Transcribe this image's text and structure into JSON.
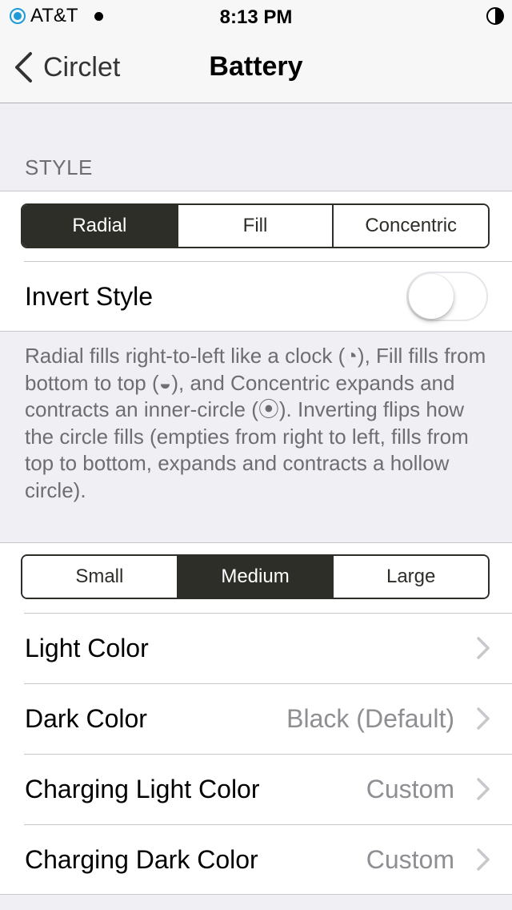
{
  "status_bar": {
    "carrier": "AT&T",
    "time": "8:13 PM",
    "signal_icon": "signal-ring-icon",
    "battery_icon": "half-circle-battery-icon"
  },
  "nav": {
    "back_label": "Circlet",
    "title": "Battery"
  },
  "style_section": {
    "header": "STYLE",
    "segments": [
      {
        "label": "Radial",
        "selected": true
      },
      {
        "label": "Fill",
        "selected": false
      },
      {
        "label": "Concentric",
        "selected": false
      }
    ],
    "invert_label": "Invert Style",
    "invert_on": false,
    "footer": "Radial fills right-to-left like a clock (◔), Fill fills from bottom to top (◒), and Concentric expands and contracts an inner-circle (⦿). Inverting flips how the circle fills (empties from right to left, fills from top to bottom, expands and contracts a hollow circle)."
  },
  "size_section": {
    "segments": [
      {
        "label": "Small",
        "selected": false
      },
      {
        "label": "Medium",
        "selected": true
      },
      {
        "label": "Large",
        "selected": false
      }
    ],
    "rows": [
      {
        "label": "Light Color",
        "value": ""
      },
      {
        "label": "Dark Color",
        "value": "Black (Default)"
      },
      {
        "label": "Charging Light Color",
        "value": "Custom"
      },
      {
        "label": "Charging Dark Color",
        "value": "Custom"
      }
    ]
  },
  "colors": {
    "accent": "#2d2e28",
    "background": "#efeff4",
    "secondary_text": "#8e8e93",
    "signal": "#1e9bd7"
  }
}
